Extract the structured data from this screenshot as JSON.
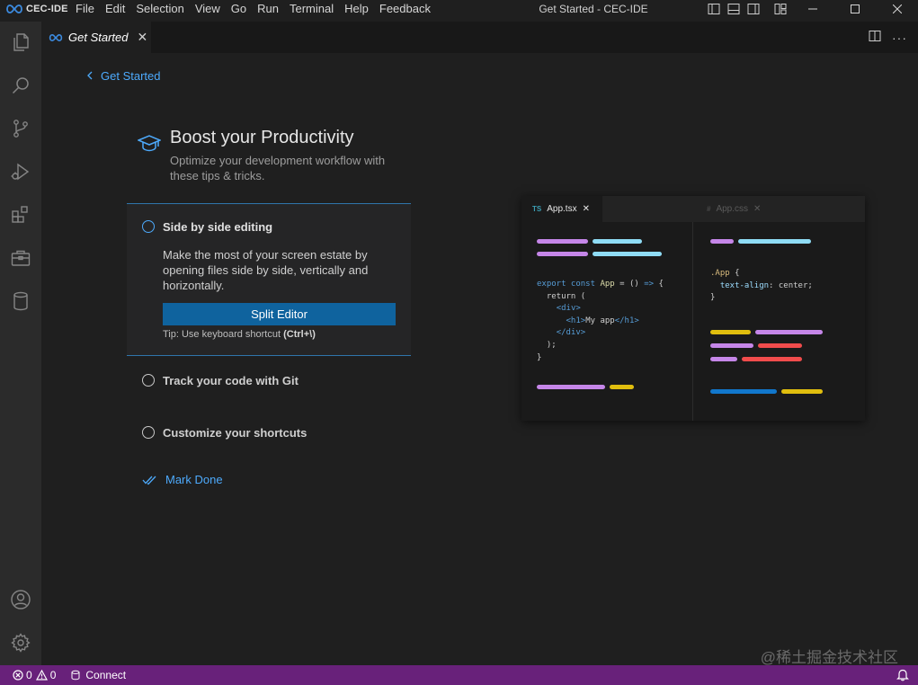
{
  "app": {
    "logo_text": "CEC-IDE",
    "window_title": "Get Started - CEC-IDE"
  },
  "menu": [
    "File",
    "Edit",
    "Selection",
    "View",
    "Go",
    "Run",
    "Terminal",
    "Help",
    "Feedback"
  ],
  "activity_bar": {
    "items": [
      "explorer-icon",
      "search-icon",
      "source-control-icon",
      "run-debug-icon",
      "extensions-icon",
      "toolbox-icon",
      "database-icon"
    ],
    "bottom": [
      "account-icon",
      "settings-gear-icon"
    ]
  },
  "tab": {
    "label": "Get Started"
  },
  "editor": {
    "back_label": "Get Started",
    "title": "Boost your Productivity",
    "subtitle": "Optimize your development workflow with these tips & tricks.",
    "steps": [
      {
        "title": "Side by side editing",
        "active": true,
        "description": "Make the most of your screen estate by opening files side by side, vertically and horizontally.",
        "button": "Split Editor",
        "tip_prefix": "Tip: Use keyboard shortcut",
        "tip_shortcut": "(Ctrl+\\)"
      },
      {
        "title": "Track your code with Git",
        "active": false
      },
      {
        "title": "Customize your shortcuts",
        "active": false
      }
    ],
    "mark_done": "Mark Done"
  },
  "illustration": {
    "tab1": {
      "lang": "TS",
      "name": "App.tsx"
    },
    "tab2": {
      "lang": "#",
      "name": "App.css"
    },
    "colors": {
      "purple": "#c586e8",
      "cyan": "#8fdcf5",
      "yellow": "#e0be0e",
      "red": "#f14c4c",
      "blue": "#1177cc"
    }
  },
  "statusbar": {
    "errors": "0",
    "warnings": "0",
    "connect": "Connect"
  },
  "watermark": "@稀土掘金技术社区",
  "colors": {
    "accent": "#4daafc",
    "status_bar": "#68217a",
    "button": "#0f639e"
  }
}
